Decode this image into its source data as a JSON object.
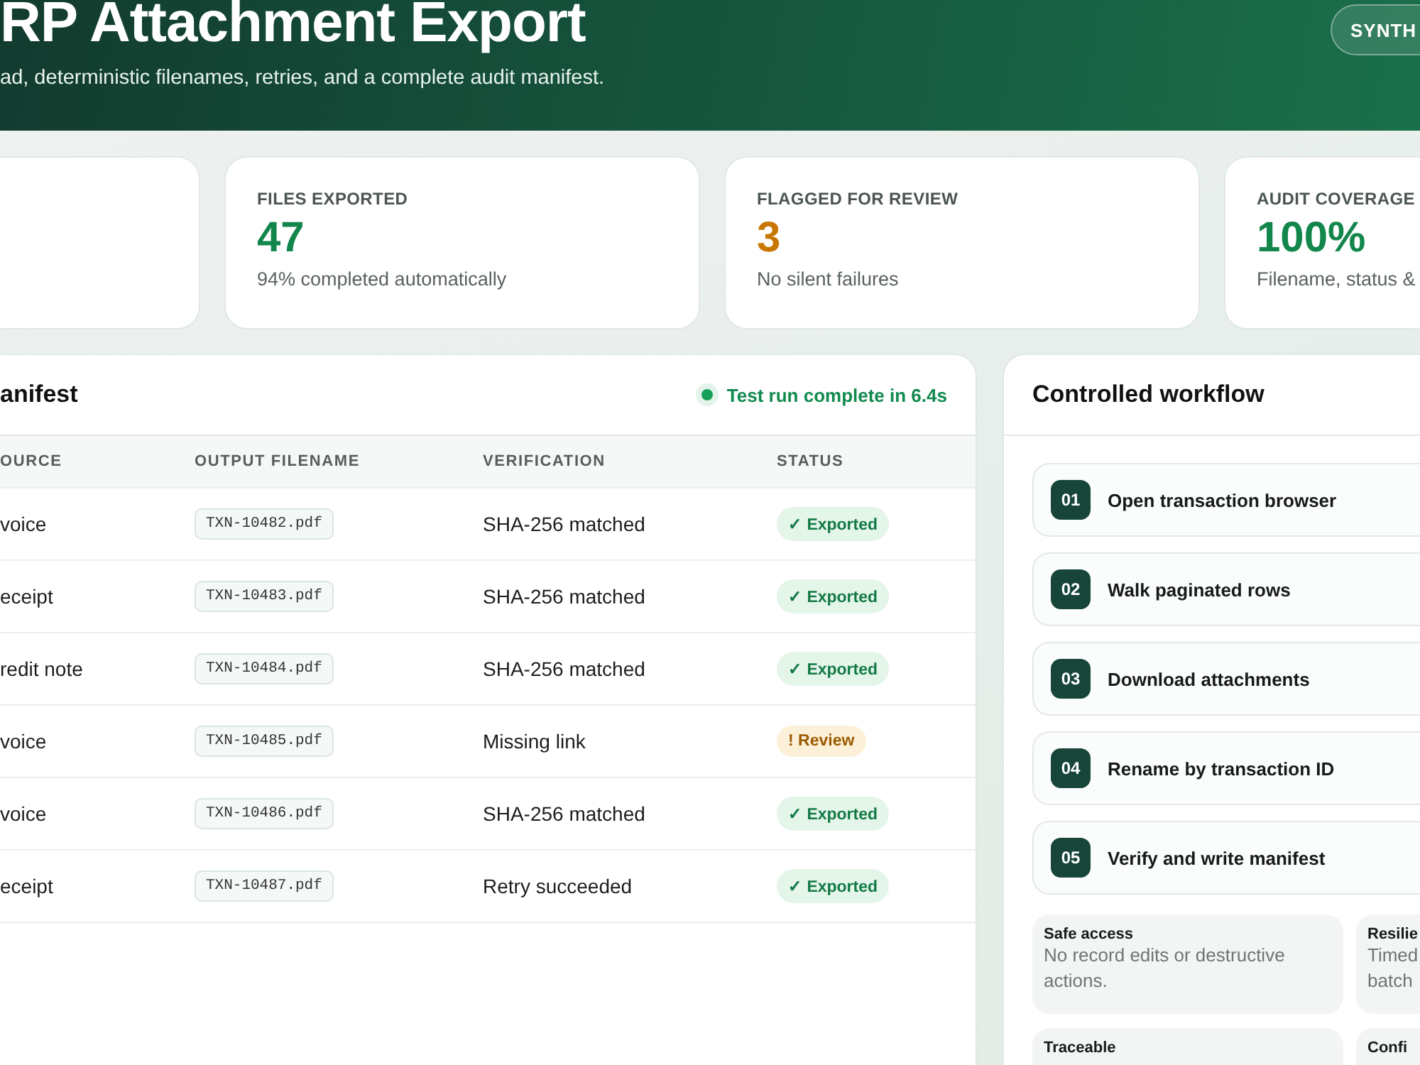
{
  "header": {
    "title": "RP Attachment Export",
    "subtitle": "ad, deterministic filenames, retries, and a complete audit manifest.",
    "button": "SYNTH"
  },
  "stats": [
    {
      "kind": "blank"
    },
    {
      "kind": "metric",
      "label": "FILES EXPORTED",
      "value": "47",
      "note": "94% completed automatically",
      "color": "#13864c"
    },
    {
      "kind": "metric",
      "label": "FLAGGED FOR REVIEW",
      "value": "3",
      "note": "No silent failures",
      "color": "#c77700"
    },
    {
      "kind": "metric",
      "label": "AUDIT COVERAGE",
      "value": "100%",
      "note": "Filename, status &",
      "color": "#13864c"
    }
  ],
  "manifest": {
    "title": "anifest",
    "status": "Test run complete in 6.4s",
    "columns": [
      "OURCE",
      "OUTPUT FILENAME",
      "VERIFICATION",
      "STATUS"
    ],
    "rows": [
      {
        "source": "voice",
        "filename": "TXN-10482.pdf",
        "verification": "SHA-256 matched",
        "status": "✓ Exported",
        "kind": "ok"
      },
      {
        "source": "eceipt",
        "filename": "TXN-10483.pdf",
        "verification": "SHA-256 matched",
        "status": "✓ Exported",
        "kind": "ok"
      },
      {
        "source": "redit note",
        "filename": "TXN-10484.pdf",
        "verification": "SHA-256 matched",
        "status": "✓ Exported",
        "kind": "ok"
      },
      {
        "source": "voice",
        "filename": "TXN-10485.pdf",
        "verification": "Missing link",
        "status": "! Review",
        "kind": "review"
      },
      {
        "source": "voice",
        "filename": "TXN-10486.pdf",
        "verification": "SHA-256 matched",
        "status": "✓ Exported",
        "kind": "ok"
      },
      {
        "source": "eceipt",
        "filename": "TXN-10487.pdf",
        "verification": "Retry succeeded",
        "status": "✓ Exported",
        "kind": "ok"
      }
    ]
  },
  "workflow": {
    "title": "Controlled workflow",
    "steps": [
      {
        "number": "01",
        "label": "Open transaction browser"
      },
      {
        "number": "02",
        "label": "Walk paginated rows"
      },
      {
        "number": "03",
        "label": "Download attachments"
      },
      {
        "number": "04",
        "label": "Rename by transaction ID"
      },
      {
        "number": "05",
        "label": "Verify and write manifest"
      }
    ],
    "tiles": [
      {
        "title": "Safe access",
        "lines": [
          "No record edits or destructive",
          "actions."
        ]
      },
      {
        "title": "Resilie",
        "lines": [
          "Timed",
          "batch"
        ]
      },
      {
        "title": "Traceable"
      },
      {
        "title": "Confi"
      }
    ]
  }
}
